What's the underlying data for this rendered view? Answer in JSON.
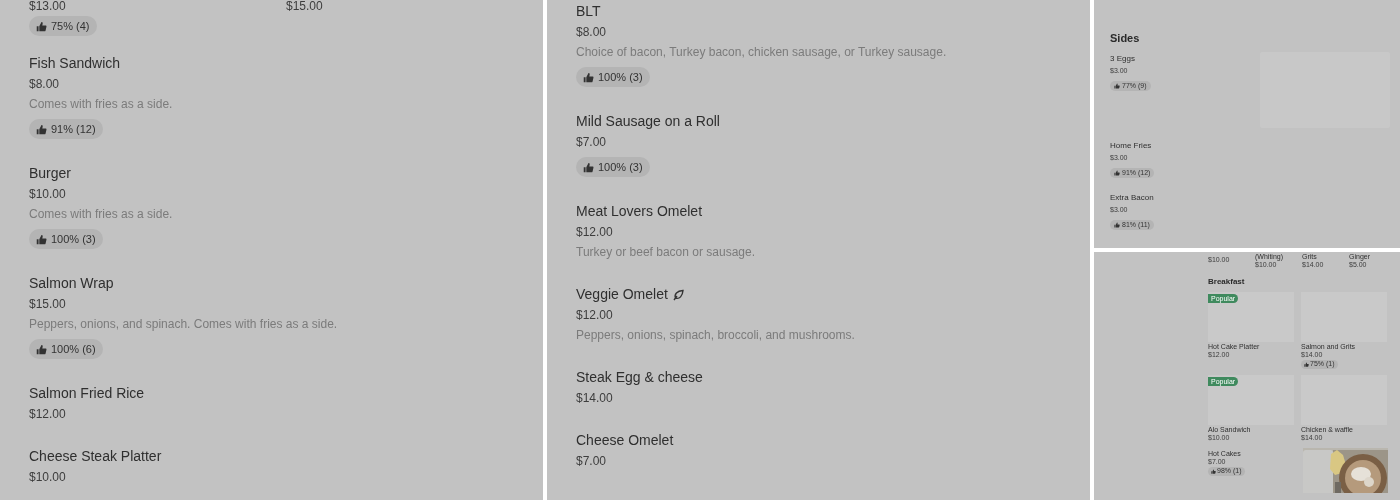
{
  "left_panel": {
    "partial_row": [
      {
        "price": "$13.00",
        "rating": "75% (4)"
      },
      {
        "price": "$15.00"
      }
    ],
    "items": [
      {
        "name": "Fish Sandwich",
        "price": "$8.00",
        "description": "Comes with fries as a side.",
        "rating": "91% (12)"
      },
      {
        "name": "Burger",
        "price": "$10.00",
        "description": "Comes with fries as a side.",
        "rating": "100% (3)"
      },
      {
        "name": "Salmon Wrap",
        "price": "$15.00",
        "description": "Peppers, onions, and spinach. Comes with fries as a side.",
        "rating": "100% (6)"
      },
      {
        "name": "Salmon Fried Rice",
        "price": "$12.00"
      },
      {
        "name": "Cheese Steak Platter",
        "price": "$10.00"
      }
    ]
  },
  "middle_panel": {
    "items": [
      {
        "name": "BLT",
        "price": "$8.00",
        "description": "Choice of bacon, Turkey bacon, chicken sausage, or Turkey sausage.",
        "rating": "100% (3)"
      },
      {
        "name": "Mild Sausage on a Roll",
        "price": "$7.00",
        "rating": "100% (3)"
      },
      {
        "name": "Meat Lovers Omelet",
        "price": "$12.00",
        "description": "Turkey or beef bacon or sausage."
      },
      {
        "name": "Veggie Omelet",
        "vegetarian": true,
        "price": "$12.00",
        "description": "Peppers, onions, spinach, broccoli, and mushrooms."
      },
      {
        "name": "Steak Egg & cheese",
        "price": "$14.00"
      },
      {
        "name": "Cheese Omelet",
        "price": "$7.00"
      }
    ]
  },
  "sides_panel": {
    "section": "Sides",
    "items": [
      {
        "name": "3 Eggs",
        "price": "$3.00",
        "rating": "77% (9)",
        "has_image": true
      },
      {
        "name": "Home Fries",
        "price": "$3.00",
        "rating": "91% (12)"
      },
      {
        "name": "Extra Bacon",
        "price": "$3.00",
        "rating": "81% (11)"
      }
    ]
  },
  "breakfast_panel": {
    "partial_row": [
      {
        "price": "$10.00"
      },
      {
        "name": "(Whiting)",
        "price": "$10.00"
      },
      {
        "name": "Grits",
        "price": "$14.00"
      },
      {
        "name": "Ginger",
        "price": "$5.00"
      }
    ],
    "section": "Breakfast",
    "cards": [
      {
        "name": "Hot Cake Platter",
        "price": "$12.00",
        "badge": "Popular"
      },
      {
        "name": "Salmon and Grits",
        "price": "$14.00",
        "rating": "75% (1)"
      },
      {
        "name": "Alo Sandwich",
        "price": "$10.00",
        "badge": "Popular"
      },
      {
        "name": "Chicken & waffle",
        "price": "$14.00"
      }
    ],
    "items": [
      {
        "name": "Hot Cakes",
        "price": "$7.00",
        "rating": "98% (1)"
      }
    ]
  }
}
